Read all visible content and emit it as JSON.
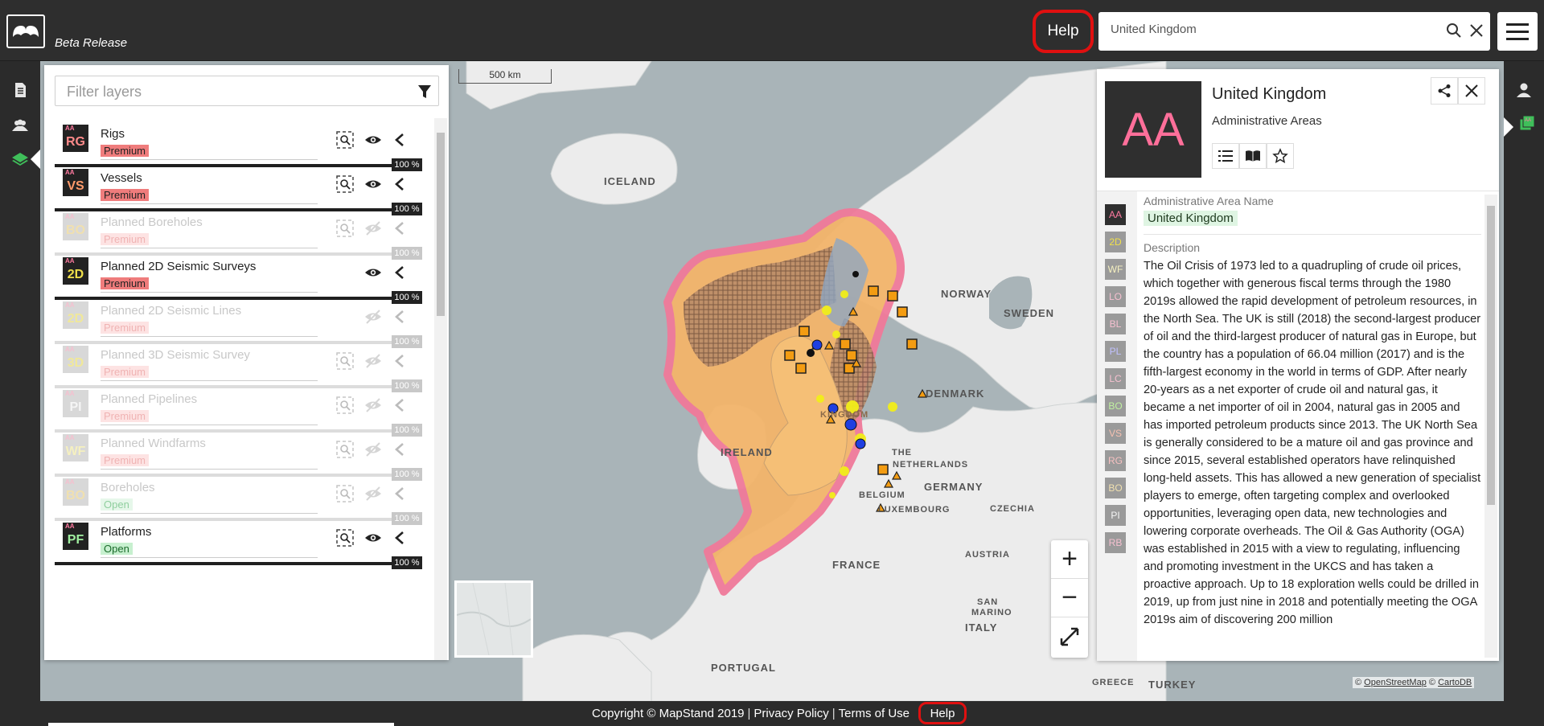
{
  "header": {
    "beta_label": "Beta Release",
    "help_label": "Help",
    "search_value": "United Kingdom"
  },
  "map": {
    "scale_label": "500 km",
    "labels": {
      "iceland": "ICELAND",
      "norway": "NORWAY",
      "sweden": "SWEDEN",
      "denmark": "DENMARK",
      "ireland": "IRELAND",
      "the": "THE",
      "netherlands": "NETHERLANDS",
      "belgium": "BELGIUM",
      "luxembourg": "LUXEMBOURG",
      "germany": "GERMANY",
      "czechia": "CZECHIA",
      "france": "FRANCE",
      "austria": "AUSTRIA",
      "san": "SAN",
      "marino": "MARINO",
      "italy": "ITALY",
      "portugal": "PORTUGAL",
      "greece": "GREECE",
      "turkey": "TURKEY",
      "kingdom_partial": "KINGDOM"
    },
    "attribution": {
      "prefix": "©",
      "osm": "OpenStreetMap",
      "mid": "©",
      "carto": "CartoDB"
    },
    "zoom_in": "+",
    "zoom_out": "−"
  },
  "layers_panel": {
    "filter_placeholder": "Filter layers",
    "layers": [
      {
        "code": "RG",
        "name": "Rigs",
        "tag": "Premium",
        "opacity": "100 %",
        "visible": true,
        "code_color": "#ff8a8a"
      },
      {
        "code": "VS",
        "name": "Vessels",
        "tag": "Premium",
        "opacity": "100 %",
        "visible": true,
        "code_color": "#ff9a6a"
      },
      {
        "code": "BO",
        "name": "Planned Boreholes",
        "tag": "Premium",
        "opacity": "100 %",
        "visible": false,
        "code_color": "#f0e0b0"
      },
      {
        "code": "2D",
        "name": "Planned 2D Seismic Surveys",
        "tag": "Premium",
        "opacity": "100 %",
        "visible": true,
        "code_color": "#f0e04a"
      },
      {
        "code": "2D",
        "name": "Planned 2D Seismic Lines",
        "tag": "Premium",
        "opacity": "100 %",
        "visible": false,
        "code_color": "#f0e89a"
      },
      {
        "code": "3D",
        "name": "Planned 3D Seismic Survey",
        "tag": "Premium",
        "opacity": "100 %",
        "visible": false,
        "code_color": "#f0e89a"
      },
      {
        "code": "PI",
        "name": "Planned Pipelines",
        "tag": "Premium",
        "opacity": "100 %",
        "visible": false,
        "code_color": "#f5f5f5"
      },
      {
        "code": "WF",
        "name": "Planned Windfarms",
        "tag": "Premium",
        "opacity": "100 %",
        "visible": false,
        "code_color": "#f5f0c0"
      },
      {
        "code": "BO",
        "name": "Boreholes",
        "tag": "Open",
        "opacity": "100 %",
        "visible": false,
        "code_color": "#f0e0b0"
      },
      {
        "code": "PF",
        "name": "Platforms",
        "tag": "Open",
        "opacity": "100 %",
        "visible": true,
        "code_color": "#a0f0a0"
      }
    ]
  },
  "info_panel": {
    "avatar": "AA",
    "title": "United Kingdom",
    "subtitle": "Administrative Areas",
    "side_badges": [
      {
        "code": "AA",
        "color": "#ff7aa0",
        "bg": "#2f2f2f"
      },
      {
        "code": "2D",
        "color": "#f0e04a",
        "bg": "#9a9a9a"
      },
      {
        "code": "WF",
        "color": "#f5f0c0",
        "bg": "#9a9a9a"
      },
      {
        "code": "LO",
        "color": "#f5c0d0",
        "bg": "#9a9a9a"
      },
      {
        "code": "BL",
        "color": "#f5c0d0",
        "bg": "#9a9a9a"
      },
      {
        "code": "PL",
        "color": "#c0c0ff",
        "bg": "#9a9a9a"
      },
      {
        "code": "LC",
        "color": "#f5c0d0",
        "bg": "#9a9a9a"
      },
      {
        "code": "BO",
        "color": "#c0f0a0",
        "bg": "#9a9a9a"
      },
      {
        "code": "VS",
        "color": "#f5c0b0",
        "bg": "#9a9a9a"
      },
      {
        "code": "RG",
        "color": "#f5c0c0",
        "bg": "#9a9a9a"
      },
      {
        "code": "BO",
        "color": "#f0e0b0",
        "bg": "#9a9a9a"
      },
      {
        "code": "PI",
        "color": "#f5f5f5",
        "bg": "#9a9a9a"
      },
      {
        "code": "RB",
        "color": "#f5c0d0",
        "bg": "#9a9a9a"
      }
    ],
    "field1_label": "Administrative Area Name",
    "field1_value": "United Kingdom",
    "field2_label": "Description",
    "description": "The Oil Crisis of 1973 led to a quadrupling of crude oil prices, which together with generous fiscal terms through the 1980 2019s allowed the rapid development of petroleum resources, in the North Sea. The UK is still (2018) the second-largest producer of oil and the third-largest producer of natural gas in Europe, but the country has a population of 66.04 million (2017) and is the fifth-largest economy in the world in terms of GDP. After nearly 20-years as a net exporter of crude oil and natural gas, it became a net importer of oil in 2004, natural gas in 2005 and has imported petroleum products since 2013. The UK North Sea is generally considered to be a mature oil and gas province and since 2015, several established operators have relinquished long-held assets. This has allowed a new generation of specialist players to emerge, often targeting complex and overlooked opportunities, leveraging open data, new technologies and lowering corporate overheads. The Oil & Gas Authority (OGA) was established in 2015 with a view to regulating, influencing and promoting investment in the UKCS and has taken a proactive approach. Up to 18 exploration wells could be drilled in 2019, up from just nine in 2018 and potentially meeting the OGA 2019s aim of discovering 200 million"
  },
  "footer": {
    "copyright": "Copyright © MapStand 2019",
    "privacy": "Privacy Policy",
    "terms": "Terms of Use",
    "help": "Help",
    "sep": "|"
  }
}
